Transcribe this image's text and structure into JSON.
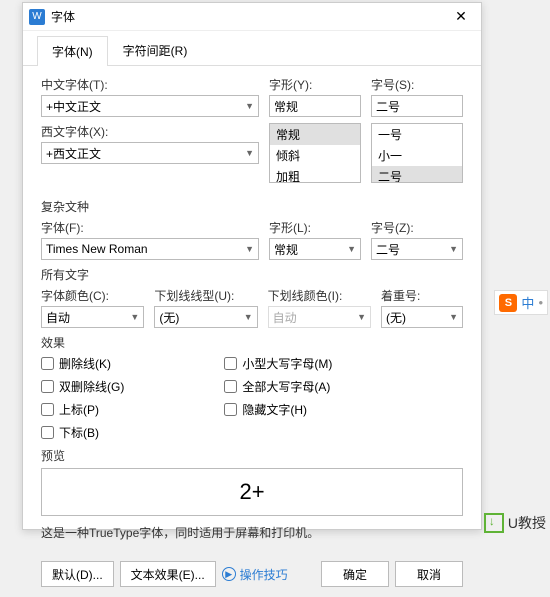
{
  "titlebar": {
    "app_icon": "W",
    "title": "字体"
  },
  "tabs": {
    "font": "字体(N)",
    "spacing": "字符间距(R)"
  },
  "cn_font": {
    "label": "中文字体(T):",
    "value": "+中文正文"
  },
  "style": {
    "label": "字形(Y):",
    "value": "常规",
    "options": [
      "常规",
      "倾斜",
      "加粗"
    ]
  },
  "size": {
    "label": "字号(S):",
    "value": "二号",
    "options": [
      "一号",
      "小一",
      "二号"
    ]
  },
  "en_font": {
    "label": "西文字体(X):",
    "value": "+西文正文"
  },
  "complex": {
    "section": "复杂文种",
    "font": {
      "label": "字体(F):",
      "value": "Times New Roman"
    },
    "style": {
      "label": "字形(L):",
      "value": "常规"
    },
    "size": {
      "label": "字号(Z):",
      "value": "二号"
    }
  },
  "all_text": {
    "section": "所有文字",
    "color": {
      "label": "字体颜色(C):",
      "value": "自动"
    },
    "underline": {
      "label": "下划线线型(U):",
      "value": "(无)"
    },
    "ucolor": {
      "label": "下划线颜色(I):",
      "value": "自动"
    },
    "emphasis": {
      "label": "着重号:",
      "value": "(无)"
    }
  },
  "effects": {
    "section": "效果",
    "left": [
      "删除线(K)",
      "双删除线(G)",
      "上标(P)",
      "下标(B)"
    ],
    "right": [
      "小型大写字母(M)",
      "全部大写字母(A)",
      "隐藏文字(H)"
    ]
  },
  "preview": {
    "label": "预览",
    "text": "2+"
  },
  "desc": "这是一种TrueType字体，同时适用于屏幕和打印机。",
  "footer": {
    "default": "默认(D)...",
    "text_effect": "文本效果(E)...",
    "tips": "操作技巧",
    "ok": "确定",
    "cancel": "取消"
  },
  "ime": {
    "s": "S",
    "ch": "中"
  },
  "watermark": "U教授"
}
